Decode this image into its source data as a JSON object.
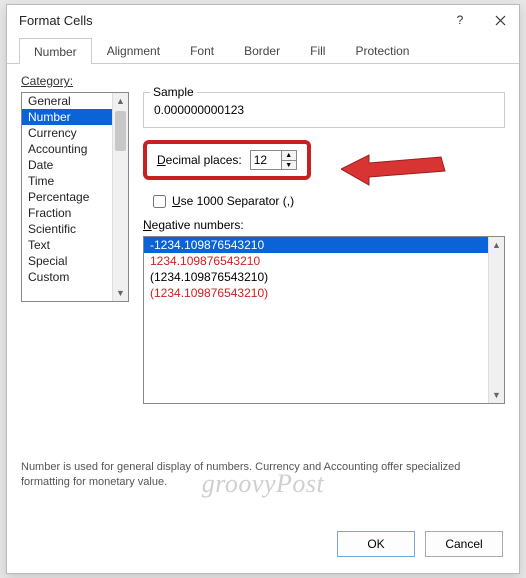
{
  "dialog": {
    "title": "Format Cells"
  },
  "tabs": [
    "Number",
    "Alignment",
    "Font",
    "Border",
    "Fill",
    "Protection"
  ],
  "activeTab": 0,
  "categoryLabel": "Category:",
  "categories": [
    "General",
    "Number",
    "Currency",
    "Accounting",
    "Date",
    "Time",
    "Percentage",
    "Fraction",
    "Scientific",
    "Text",
    "Special",
    "Custom"
  ],
  "selectedCategory": 1,
  "sample": {
    "label": "Sample",
    "value": "0.000000000123"
  },
  "decimal": {
    "label": "Decimal places:",
    "value": "12"
  },
  "separator": {
    "label": "Use 1000 Separator (,)",
    "checked": false
  },
  "negative": {
    "label": "Negative numbers:",
    "items": [
      {
        "text": "-1234.109876543210",
        "selected": true,
        "red": false
      },
      {
        "text": "1234.109876543210",
        "selected": false,
        "red": true
      },
      {
        "text": "(1234.109876543210)",
        "selected": false,
        "red": false
      },
      {
        "text": "(1234.109876543210)",
        "selected": false,
        "red": true
      }
    ]
  },
  "description": "Number is used for general display of numbers.  Currency and Accounting offer specialized formatting for monetary value.",
  "buttons": {
    "ok": "OK",
    "cancel": "Cancel"
  },
  "watermark": "groovyPost"
}
